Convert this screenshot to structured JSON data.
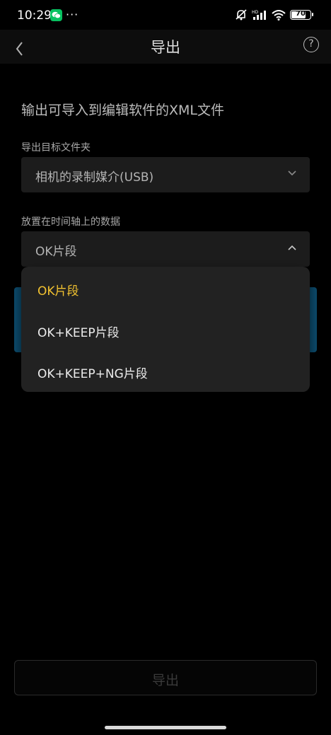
{
  "status_bar": {
    "time": "10:29",
    "dots": "···",
    "battery": "70"
  },
  "header": {
    "title": "导出",
    "help_label": "?"
  },
  "description": "输出可导入到编辑软件的XML文件",
  "target_folder": {
    "label": "导出目标文件夹",
    "value": "相机的录制媒介(USB)"
  },
  "timeline_data": {
    "label": "放置在时间轴上的数据",
    "value": "OK片段",
    "options": [
      "OK片段",
      "OK+KEEP片段",
      "OK+KEEP+NG片段"
    ],
    "selected_index": 0
  },
  "export_button": {
    "label": "导出"
  },
  "colors": {
    "accent_selected": "#f2c230",
    "background": "#000000",
    "wechat": "#07c160"
  },
  "icons": {
    "back": "chevron-left-icon",
    "help": "question-circle-icon",
    "chevron_down": "chevron-down-icon",
    "chevron_up": "chevron-up-icon"
  }
}
